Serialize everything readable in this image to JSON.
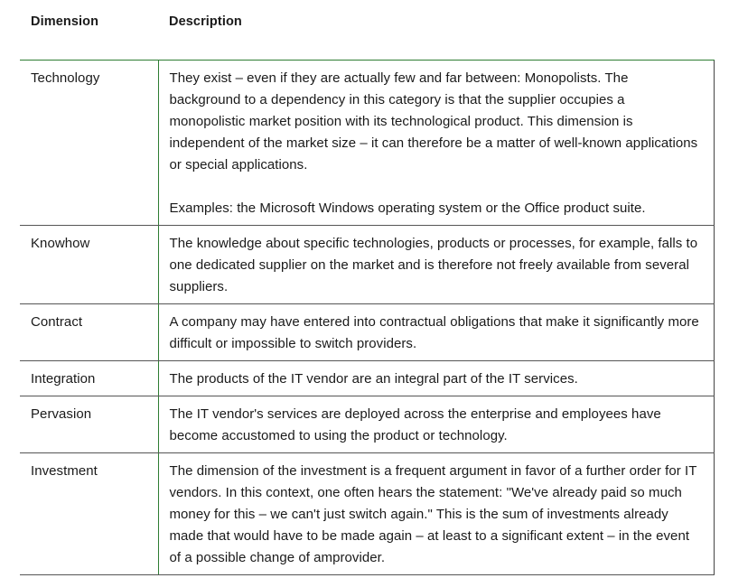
{
  "table": {
    "headers": {
      "dimension": "Dimension",
      "description": "Description"
    },
    "rows": [
      {
        "dimension": "Technology",
        "description": [
          "They exist – even if they are actually few and far between: Monopolists. The background to a dependency in this category is that the supplier occupies a monopolistic market position with its technological product. This dimension is independent of the market size – it can therefore be a matter of well-known applications or special applications.",
          "Examples: the Microsoft Windows operating system or the Office product suite."
        ]
      },
      {
        "dimension": "Knowhow",
        "description": [
          "The knowledge about specific technologies, products or processes, for example, falls to one dedicated supplier on the market and is therefore not freely available from several suppliers."
        ]
      },
      {
        "dimension": "Contract",
        "description": [
          "A company may have entered into contractual obligations that make it significantly more difficult or impossible to switch providers."
        ]
      },
      {
        "dimension": "Integration",
        "description": [
          "The products of the IT vendor are an integral part of the IT services."
        ]
      },
      {
        "dimension": "Pervasion",
        "description": [
          "The IT vendor's services are deployed across the enterprise and employees have become accustomed to using the product or technology."
        ]
      },
      {
        "dimension": "Investment",
        "description": [
          "The dimension of the investment is a frequent argument in favor of a further order for IT vendors. In this context, one often hears the statement: \"We've already paid so much money for this – we can't just switch again.\" This is the sum of investments already made that would have to be made again – at least to a significant extent – in the event of a possible change of amprovider."
        ]
      }
    ]
  },
  "colors": {
    "accent_border": "#2e7d32",
    "row_border": "#555555",
    "text": "#1a1a1a"
  }
}
